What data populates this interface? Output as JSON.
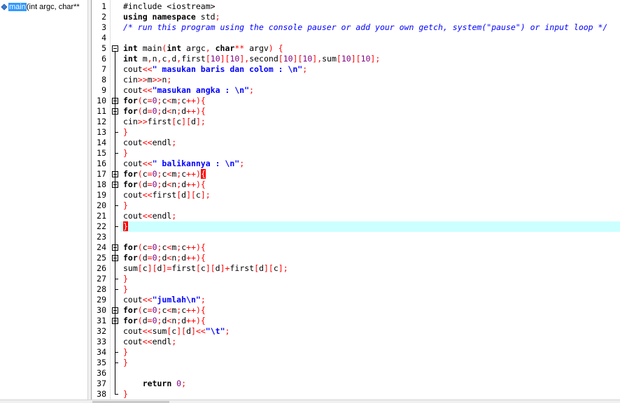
{
  "class_browser": {
    "item_name": "main",
    "item_params": " (int argc, char**"
  },
  "editor": {
    "current_line": 22,
    "lines": [
      {
        "n": "1",
        "t": [
          [
            "p",
            "#include <iostream>"
          ]
        ]
      },
      {
        "n": "2",
        "t": [
          [
            "k",
            "using namespace "
          ],
          [
            "p",
            "std"
          ],
          [
            "o",
            ";"
          ]
        ]
      },
      {
        "n": "3",
        "t": [
          [
            "c",
            "/* run this program using the console pauser or add your own getch, system(\"pause\") or input loop */"
          ]
        ]
      },
      {
        "n": "4",
        "t": []
      },
      {
        "n": "5",
        "t": [
          [
            "k",
            "int "
          ],
          [
            "p",
            "main"
          ],
          [
            "o",
            "("
          ],
          [
            "k",
            "int "
          ],
          [
            "p",
            "argc"
          ],
          [
            "o",
            ", "
          ],
          [
            "k",
            "char"
          ],
          [
            "o",
            "** "
          ],
          [
            "p",
            "argv"
          ],
          [
            "o",
            ") {"
          ]
        ]
      },
      {
        "n": "6",
        "t": [
          [
            "k",
            "int "
          ],
          [
            "p",
            "m"
          ],
          [
            "o",
            ","
          ],
          [
            "p",
            "n"
          ],
          [
            "o",
            ","
          ],
          [
            "p",
            "c"
          ],
          [
            "o",
            ","
          ],
          [
            "p",
            "d"
          ],
          [
            "o",
            ","
          ],
          [
            "p",
            "first"
          ],
          [
            "o",
            "["
          ],
          [
            "n",
            "10"
          ],
          [
            "o",
            "]["
          ],
          [
            "n",
            "10"
          ],
          [
            "o",
            "],"
          ],
          [
            "p",
            "second"
          ],
          [
            "o",
            "["
          ],
          [
            "n",
            "10"
          ],
          [
            "o",
            "]["
          ],
          [
            "n",
            "10"
          ],
          [
            "o",
            "],"
          ],
          [
            "p",
            "sum"
          ],
          [
            "o",
            "["
          ],
          [
            "n",
            "10"
          ],
          [
            "o",
            "]["
          ],
          [
            "n",
            "10"
          ],
          [
            "o",
            "];"
          ]
        ]
      },
      {
        "n": "7",
        "t": [
          [
            "p",
            "cout"
          ],
          [
            "o",
            "<<"
          ],
          [
            "s",
            "\" masukan baris dan colom : \\n\""
          ],
          [
            "o",
            ";"
          ]
        ]
      },
      {
        "n": "8",
        "t": [
          [
            "p",
            "cin"
          ],
          [
            "o",
            ">>"
          ],
          [
            "p",
            "m"
          ],
          [
            "o",
            ">>"
          ],
          [
            "p",
            "n"
          ],
          [
            "o",
            ";"
          ]
        ]
      },
      {
        "n": "9",
        "t": [
          [
            "p",
            "cout"
          ],
          [
            "o",
            "<<"
          ],
          [
            "s",
            "\"masukan angka : \\n\""
          ],
          [
            "o",
            ";"
          ]
        ]
      },
      {
        "n": "10",
        "t": [
          [
            "k",
            "for"
          ],
          [
            "o",
            "("
          ],
          [
            "p",
            "c"
          ],
          [
            "o",
            "="
          ],
          [
            "n",
            "0"
          ],
          [
            "o",
            ";"
          ],
          [
            "p",
            "c"
          ],
          [
            "o",
            "<"
          ],
          [
            "p",
            "m"
          ],
          [
            "o",
            ";"
          ],
          [
            "p",
            "c"
          ],
          [
            "o",
            "++){"
          ]
        ]
      },
      {
        "n": "11",
        "t": [
          [
            "k",
            "for"
          ],
          [
            "o",
            "("
          ],
          [
            "p",
            "d"
          ],
          [
            "o",
            "="
          ],
          [
            "n",
            "0"
          ],
          [
            "o",
            ";"
          ],
          [
            "p",
            "d"
          ],
          [
            "o",
            "<"
          ],
          [
            "p",
            "n"
          ],
          [
            "o",
            ";"
          ],
          [
            "p",
            "d"
          ],
          [
            "o",
            "++){"
          ]
        ]
      },
      {
        "n": "12",
        "t": [
          [
            "p",
            "cin"
          ],
          [
            "o",
            ">>"
          ],
          [
            "p",
            "first"
          ],
          [
            "o",
            "["
          ],
          [
            "p",
            "c"
          ],
          [
            "o",
            "]["
          ],
          [
            "p",
            "d"
          ],
          [
            "o",
            "];"
          ]
        ]
      },
      {
        "n": "13",
        "t": [
          [
            "o",
            "}"
          ]
        ]
      },
      {
        "n": "14",
        "t": [
          [
            "p",
            "cout"
          ],
          [
            "o",
            "<<"
          ],
          [
            "p",
            "endl"
          ],
          [
            "o",
            ";"
          ]
        ]
      },
      {
        "n": "15",
        "t": [
          [
            "o",
            "}"
          ]
        ]
      },
      {
        "n": "16",
        "t": [
          [
            "p",
            "cout"
          ],
          [
            "o",
            "<<"
          ],
          [
            "s",
            "\" balikannya : \\n\""
          ],
          [
            "o",
            ";"
          ]
        ]
      },
      {
        "n": "17",
        "t": [
          [
            "k",
            "for"
          ],
          [
            "o",
            "("
          ],
          [
            "p",
            "c"
          ],
          [
            "o",
            "="
          ],
          [
            "n",
            "0"
          ],
          [
            "o",
            ";"
          ],
          [
            "p",
            "c"
          ],
          [
            "o",
            "<"
          ],
          [
            "p",
            "m"
          ],
          [
            "o",
            ";"
          ],
          [
            "p",
            "c"
          ],
          [
            "o",
            "++)"
          ],
          [
            "cur",
            "{"
          ]
        ]
      },
      {
        "n": "18",
        "t": [
          [
            "k",
            "for"
          ],
          [
            "o",
            "("
          ],
          [
            "p",
            "d"
          ],
          [
            "o",
            "="
          ],
          [
            "n",
            "0"
          ],
          [
            "o",
            ";"
          ],
          [
            "p",
            "d"
          ],
          [
            "o",
            "<"
          ],
          [
            "p",
            "n"
          ],
          [
            "o",
            ";"
          ],
          [
            "p",
            "d"
          ],
          [
            "o",
            "++){"
          ]
        ]
      },
      {
        "n": "19",
        "t": [
          [
            "p",
            "cout"
          ],
          [
            "o",
            "<<"
          ],
          [
            "p",
            "first"
          ],
          [
            "o",
            "["
          ],
          [
            "p",
            "d"
          ],
          [
            "o",
            "]["
          ],
          [
            "p",
            "c"
          ],
          [
            "o",
            "];"
          ]
        ]
      },
      {
        "n": "20",
        "t": [
          [
            "o",
            "}"
          ]
        ]
      },
      {
        "n": "21",
        "t": [
          [
            "p",
            "cout"
          ],
          [
            "o",
            "<<"
          ],
          [
            "p",
            "endl"
          ],
          [
            "o",
            ";"
          ]
        ]
      },
      {
        "n": "22",
        "t": [
          [
            "cur",
            "}"
          ]
        ]
      },
      {
        "n": "23",
        "t": []
      },
      {
        "n": "24",
        "t": [
          [
            "k",
            "for"
          ],
          [
            "o",
            "("
          ],
          [
            "p",
            "c"
          ],
          [
            "o",
            "="
          ],
          [
            "n",
            "0"
          ],
          [
            "o",
            ";"
          ],
          [
            "p",
            "c"
          ],
          [
            "o",
            "<"
          ],
          [
            "p",
            "m"
          ],
          [
            "o",
            ";"
          ],
          [
            "p",
            "c"
          ],
          [
            "o",
            "++){"
          ]
        ]
      },
      {
        "n": "25",
        "t": [
          [
            "k",
            "for"
          ],
          [
            "o",
            "("
          ],
          [
            "p",
            "d"
          ],
          [
            "o",
            "="
          ],
          [
            "n",
            "0"
          ],
          [
            "o",
            ";"
          ],
          [
            "p",
            "d"
          ],
          [
            "o",
            "<"
          ],
          [
            "p",
            "n"
          ],
          [
            "o",
            ";"
          ],
          [
            "p",
            "d"
          ],
          [
            "o",
            "++){"
          ]
        ]
      },
      {
        "n": "26",
        "t": [
          [
            "p",
            "sum"
          ],
          [
            "o",
            "["
          ],
          [
            "p",
            "c"
          ],
          [
            "o",
            "]["
          ],
          [
            "p",
            "d"
          ],
          [
            "o",
            "]="
          ],
          [
            "p",
            "first"
          ],
          [
            "o",
            "["
          ],
          [
            "p",
            "c"
          ],
          [
            "o",
            "]["
          ],
          [
            "p",
            "d"
          ],
          [
            "o",
            "]+"
          ],
          [
            "p",
            "first"
          ],
          [
            "o",
            "["
          ],
          [
            "p",
            "d"
          ],
          [
            "o",
            "]["
          ],
          [
            "p",
            "c"
          ],
          [
            "o",
            "];"
          ]
        ]
      },
      {
        "n": "27",
        "t": [
          [
            "o",
            "}"
          ]
        ]
      },
      {
        "n": "28",
        "t": [
          [
            "o",
            "}"
          ]
        ]
      },
      {
        "n": "29",
        "t": [
          [
            "p",
            "cout"
          ],
          [
            "o",
            "<<"
          ],
          [
            "s",
            "\"jumlah\\n\""
          ],
          [
            "o",
            ";"
          ]
        ]
      },
      {
        "n": "30",
        "t": [
          [
            "k",
            "for"
          ],
          [
            "o",
            "("
          ],
          [
            "p",
            "c"
          ],
          [
            "o",
            "="
          ],
          [
            "n",
            "0"
          ],
          [
            "o",
            ";"
          ],
          [
            "p",
            "c"
          ],
          [
            "o",
            "<"
          ],
          [
            "p",
            "m"
          ],
          [
            "o",
            ";"
          ],
          [
            "p",
            "c"
          ],
          [
            "o",
            "++){"
          ]
        ]
      },
      {
        "n": "31",
        "t": [
          [
            "k",
            "for"
          ],
          [
            "o",
            "("
          ],
          [
            "p",
            "d"
          ],
          [
            "o",
            "="
          ],
          [
            "n",
            "0"
          ],
          [
            "o",
            ";"
          ],
          [
            "p",
            "d"
          ],
          [
            "o",
            "<"
          ],
          [
            "p",
            "n"
          ],
          [
            "o",
            ";"
          ],
          [
            "p",
            "d"
          ],
          [
            "o",
            "++){"
          ]
        ]
      },
      {
        "n": "32",
        "t": [
          [
            "p",
            "cout"
          ],
          [
            "o",
            "<<"
          ],
          [
            "p",
            "sum"
          ],
          [
            "o",
            "["
          ],
          [
            "p",
            "c"
          ],
          [
            "o",
            "]["
          ],
          [
            "p",
            "d"
          ],
          [
            "o",
            "]<<"
          ],
          [
            "s",
            "\"\\t\""
          ],
          [
            "o",
            ";"
          ]
        ]
      },
      {
        "n": "33",
        "t": [
          [
            "p",
            "cout"
          ],
          [
            "o",
            "<<"
          ],
          [
            "p",
            "endl"
          ],
          [
            "o",
            ";"
          ]
        ]
      },
      {
        "n": "34",
        "t": [
          [
            "o",
            "}"
          ]
        ]
      },
      {
        "n": "35",
        "t": [
          [
            "o",
            "}"
          ]
        ]
      },
      {
        "n": "36",
        "t": []
      },
      {
        "n": "37",
        "t": [
          [
            "p",
            "    "
          ],
          [
            "k",
            "return "
          ],
          [
            "n",
            "0"
          ],
          [
            "o",
            ";"
          ]
        ]
      },
      {
        "n": "38",
        "t": [
          [
            "o",
            "}"
          ]
        ]
      }
    ]
  },
  "colors": {
    "keyword": "#000000",
    "operator": "#ff0000",
    "number": "#800080",
    "string": "#0000ff",
    "comment": "#0000ff",
    "current_line_bg": "#ccffff",
    "selection": "#3399ff"
  },
  "icons": {
    "class_item_icon": "function-diamond-icon",
    "fold_icon": "fold-minus-icon"
  }
}
